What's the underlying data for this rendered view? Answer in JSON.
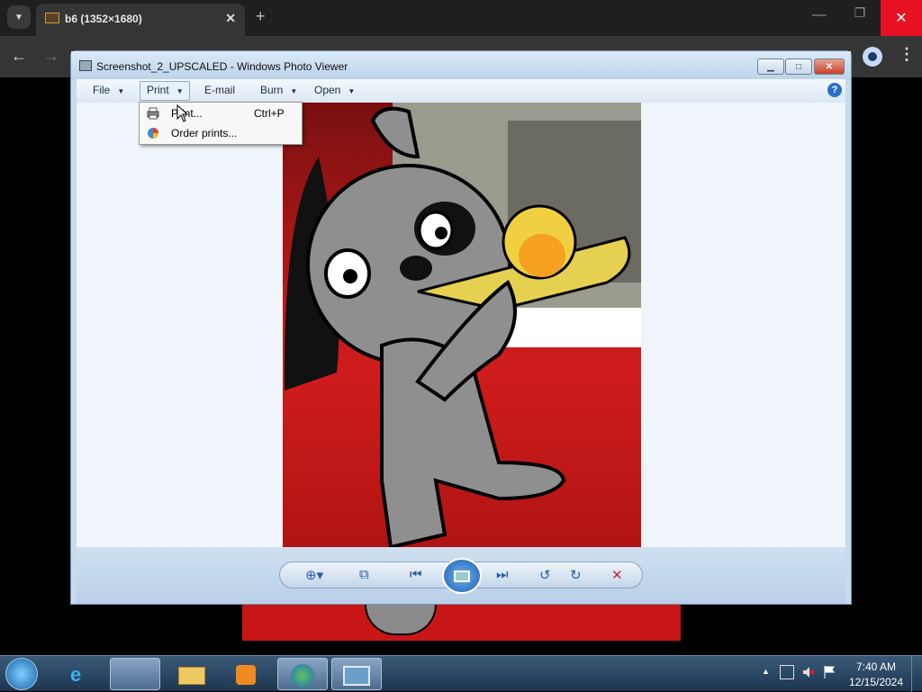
{
  "browser": {
    "tab_title": "b6 (1352×1680)",
    "tab_close": "✕",
    "new_tab": "+",
    "back": "←",
    "forward": "→",
    "menu": "⋮",
    "window_min": "—",
    "window_max": "❐",
    "window_close": "✕"
  },
  "viewer": {
    "title": "Screenshot_2_UPSCALED - Windows Photo Viewer",
    "menu": {
      "file": "File",
      "print": "Print",
      "email": "E-mail",
      "burn": "Burn",
      "open": "Open"
    },
    "help": "?",
    "print_menu": [
      {
        "label": "Print...",
        "shortcut": "Ctrl+P",
        "icon": "printer-icon"
      },
      {
        "label": "Order prints...",
        "shortcut": "",
        "icon": "order-prints-icon"
      }
    ],
    "controls": {
      "zoom": "zoom-icon",
      "actual_size": "fit-window-icon",
      "previous": "previous-icon",
      "slideshow": "slideshow-icon",
      "next": "next-icon",
      "rotate_ccw": "rotate-counterclockwise-icon",
      "rotate_cw": "rotate-clockwise-icon",
      "delete": "delete-icon"
    }
  },
  "taskbar": {
    "time": "7:40 AM",
    "date": "12/15/2024",
    "apps": [
      "photo-viewer-blue-icon",
      "internet-explorer-icon",
      "file-explorer-icon",
      "media-player-icon",
      "download-manager-icon",
      "windows-photo-viewer-icon"
    ]
  },
  "colors": {
    "accent": "#2a5ca8",
    "close_red": "#e81123",
    "photo_red": "#c81a1a",
    "taskbar": "#1e3650"
  }
}
